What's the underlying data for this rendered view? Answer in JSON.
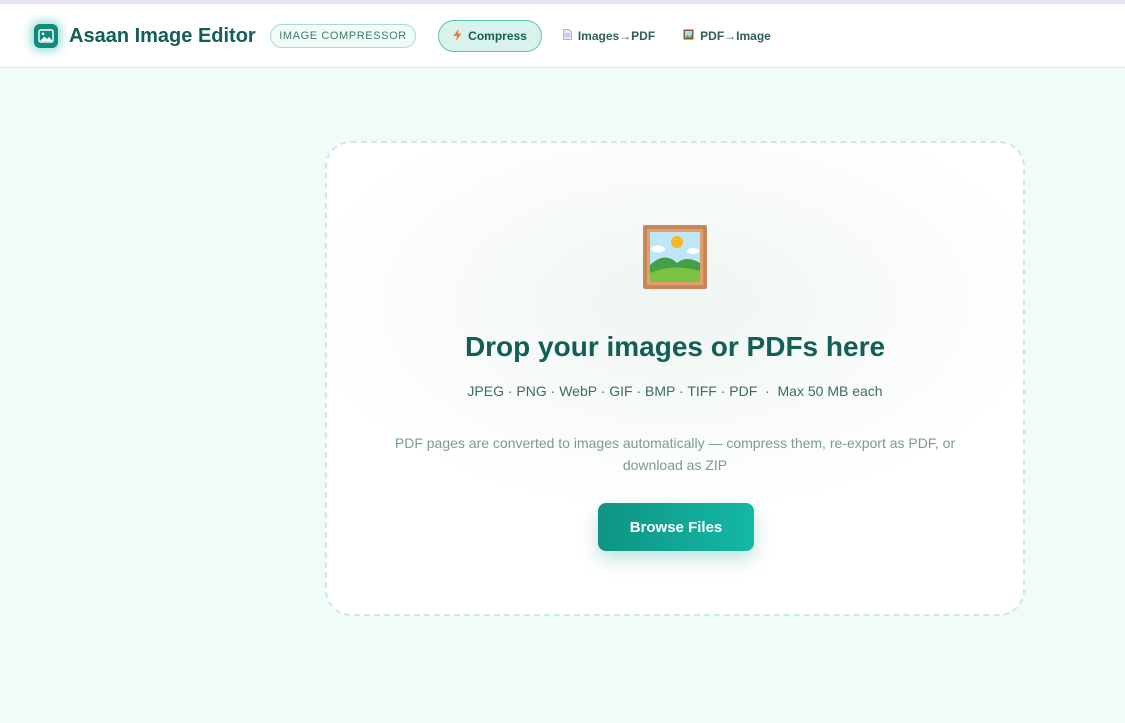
{
  "header": {
    "brand": "Asaan Image Editor",
    "tag": "IMAGE COMPRESSOR",
    "nav": [
      {
        "label": "Compress",
        "icon": "lightning-icon",
        "active": true
      },
      {
        "label": "Images→PDF",
        "icon": "document-icon",
        "active": false
      },
      {
        "label": "PDF→Image",
        "icon": "framed-picture-icon",
        "active": false
      }
    ]
  },
  "dropzone": {
    "icon": "framed-picture-icon",
    "title": "Drop your images or PDFs here",
    "formats": "JPEG · PNG · WebP · GIF · BMP · TIFF · PDF  ·  Max 50 MB each",
    "note": "PDF pages are converted to images automatically — compress them, re-export as PDF, or download as ZIP",
    "button": "Browse Files"
  },
  "colors": {
    "accent": "#14b8a6",
    "brand_text": "#135e55",
    "background": "#f1fcf9"
  }
}
